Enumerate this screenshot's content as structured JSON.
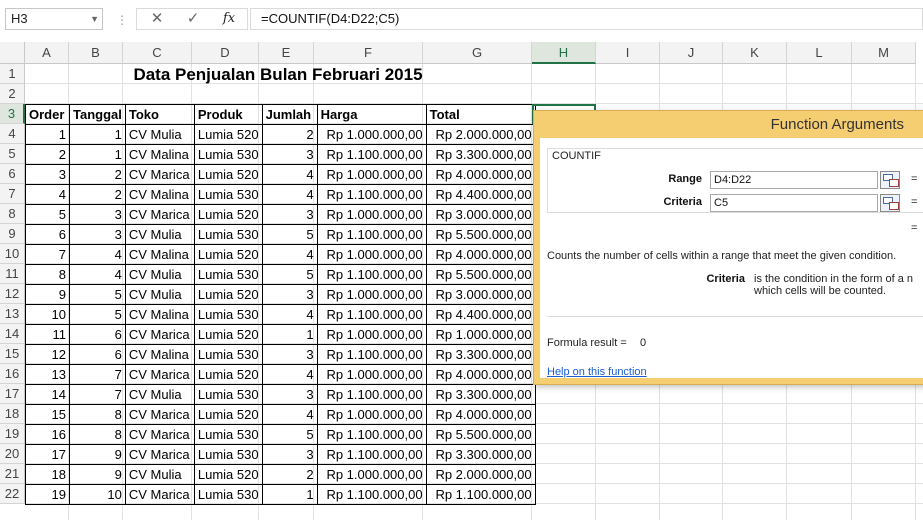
{
  "formula_bar": {
    "name_box": "H3",
    "cancel_glyph": "✕",
    "enter_glyph": "✓",
    "fx_label": "fx",
    "formula": "=COUNTIF(D4:D22;C5)"
  },
  "columns": [
    "A",
    "B",
    "C",
    "D",
    "E",
    "F",
    "G",
    "H",
    "I",
    "J",
    "K",
    "L",
    "M"
  ],
  "rows": [
    "1",
    "2",
    "3",
    "4",
    "5",
    "6",
    "7",
    "8",
    "9",
    "10",
    "11",
    "12",
    "13",
    "14",
    "15",
    "16",
    "17",
    "18",
    "19",
    "20",
    "21",
    "22"
  ],
  "sheet": {
    "title": "Data Penjualan Bulan Februari 2015",
    "headers": [
      "Order",
      "Tanggal",
      "Toko",
      "Produk",
      "Jumlah",
      "Harga",
      "Total"
    ],
    "data": [
      [
        "1",
        "1",
        "CV Mulia",
        "Lumia 520",
        "2",
        "Rp 1.000.000,00",
        "Rp 2.000.000,00"
      ],
      [
        "2",
        "1",
        "CV Malina",
        "Lumia 530",
        "3",
        "Rp 1.100.000,00",
        "Rp 3.300.000,00"
      ],
      [
        "3",
        "2",
        "CV Marica",
        "Lumia 520",
        "4",
        "Rp 1.000.000,00",
        "Rp 4.000.000,00"
      ],
      [
        "4",
        "2",
        "CV Malina",
        "Lumia 530",
        "4",
        "Rp 1.100.000,00",
        "Rp 4.400.000,00"
      ],
      [
        "5",
        "3",
        "CV Marica",
        "Lumia 520",
        "3",
        "Rp 1.000.000,00",
        "Rp 3.000.000,00"
      ],
      [
        "6",
        "3",
        "CV Mulia",
        "Lumia 530",
        "5",
        "Rp 1.100.000,00",
        "Rp 5.500.000,00"
      ],
      [
        "7",
        "4",
        "CV Malina",
        "Lumia 520",
        "4",
        "Rp 1.000.000,00",
        "Rp 4.000.000,00"
      ],
      [
        "8",
        "4",
        "CV Mulia",
        "Lumia 530",
        "5",
        "Rp 1.100.000,00",
        "Rp 5.500.000,00"
      ],
      [
        "9",
        "5",
        "CV Mulia",
        "Lumia 520",
        "3",
        "Rp 1.000.000,00",
        "Rp 3.000.000,00"
      ],
      [
        "10",
        "5",
        "CV Malina",
        "Lumia 530",
        "4",
        "Rp 1.100.000,00",
        "Rp 4.400.000,00"
      ],
      [
        "11",
        "6",
        "CV Marica",
        "Lumia 520",
        "1",
        "Rp 1.000.000,00",
        "Rp 1.000.000,00"
      ],
      [
        "12",
        "6",
        "CV Malina",
        "Lumia 530",
        "3",
        "Rp 1.100.000,00",
        "Rp 3.300.000,00"
      ],
      [
        "13",
        "7",
        "CV Marica",
        "Lumia 520",
        "4",
        "Rp 1.000.000,00",
        "Rp 4.000.000,00"
      ],
      [
        "14",
        "7",
        "CV Mulia",
        "Lumia 530",
        "3",
        "Rp 1.100.000,00",
        "Rp 3.300.000,00"
      ],
      [
        "15",
        "8",
        "CV Marica",
        "Lumia 520",
        "4",
        "Rp 1.000.000,00",
        "Rp 4.000.000,00"
      ],
      [
        "16",
        "8",
        "CV Marica",
        "Lumia 530",
        "5",
        "Rp 1.100.000,00",
        "Rp 5.500.000,00"
      ],
      [
        "17",
        "9",
        "CV Marica",
        "Lumia 530",
        "3",
        "Rp 1.100.000,00",
        "Rp 3.300.000,00"
      ],
      [
        "18",
        "9",
        "CV Mulia",
        "Lumia 520",
        "2",
        "Rp 1.000.000,00",
        "Rp 2.000.000,00"
      ],
      [
        "19",
        "10",
        "CV Marica",
        "Lumia 530",
        "1",
        "Rp 1.100.000,00",
        "Rp 1.100.000,00"
      ]
    ]
  },
  "dialog": {
    "title": "Function Arguments",
    "function_name": "COUNTIF",
    "range_label": "Range",
    "range_value": "D4:D22",
    "criteria_label": "Criteria",
    "criteria_value": "C5",
    "eq": "=",
    "description": "Counts the number of cells within a range that meet the given condition.",
    "criteria_help_label": "Criteria",
    "criteria_help_text": "is the condition in the form of a n\nwhich cells will be counted.",
    "formula_result_label": "Formula result =",
    "formula_result_value": "0",
    "help_link": "Help on this function"
  },
  "colors": {
    "accent": "#217346",
    "dialog_frame": "#f6ce72",
    "link": "#1a5ed1"
  }
}
